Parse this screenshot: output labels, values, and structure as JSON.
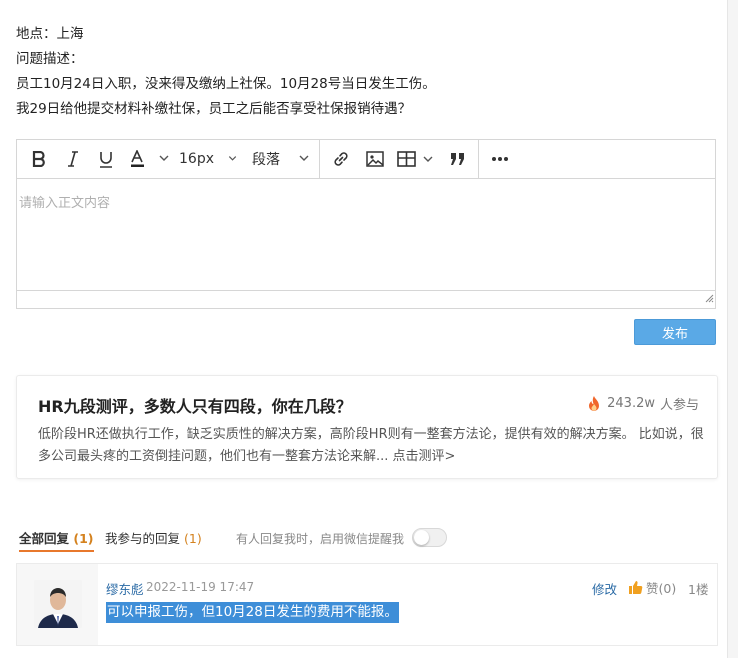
{
  "question": {
    "location": "地点：上海",
    "desc_label": "问题描述：",
    "line1": "员工10月24日入职，没来得及缴纳上社保。10月28号当日发生工伤。",
    "line2": "我29日给他提交材料补缴社保，员工之后能否享受社保报销待遇？"
  },
  "editor": {
    "font_size": "16px",
    "paragraph": "段落",
    "placeholder": "请输入正文内容",
    "toolbar_icons": [
      "bold-icon",
      "italic-icon",
      "underline-icon",
      "font-color-icon",
      "link-icon",
      "image-icon",
      "table-icon",
      "quote-icon",
      "more-icon"
    ],
    "publish_label": "发布"
  },
  "promo": {
    "title": "HR九段测评，多数人只有四段，你在几段？",
    "participants": "243.2w",
    "participants_suffix": "人参与",
    "desc": "低阶段HR还做执行工作，缺乏实质性的解决方案，高阶段HR则有一整套方法论，提供有效的解决方案。 比如说，很多公司最头疼的工资倒挂问题，他们也有一整套方法论来解...",
    "link": "点击测评>"
  },
  "tabs": {
    "all_label": "全部回复",
    "all_count": "(1)",
    "mine_label": "我参与的回复",
    "mine_count": "(1)",
    "notify_text": "有人回复我时，启用微信提醒我",
    "notify_enabled": false
  },
  "reply": {
    "author": "缪东彪",
    "time": "2022-11-19 17:47",
    "edit_label": "修改",
    "like_label": "赞(0)",
    "floor": "1楼",
    "content": "可以申报工伤，但10月28日发生的费用不能报。"
  },
  "colors": {
    "accent_orange": "#e8782c",
    "publish_blue": "#5aa9e6",
    "link_blue": "#2a6aa5",
    "selection_blue": "#3e8ed8"
  }
}
